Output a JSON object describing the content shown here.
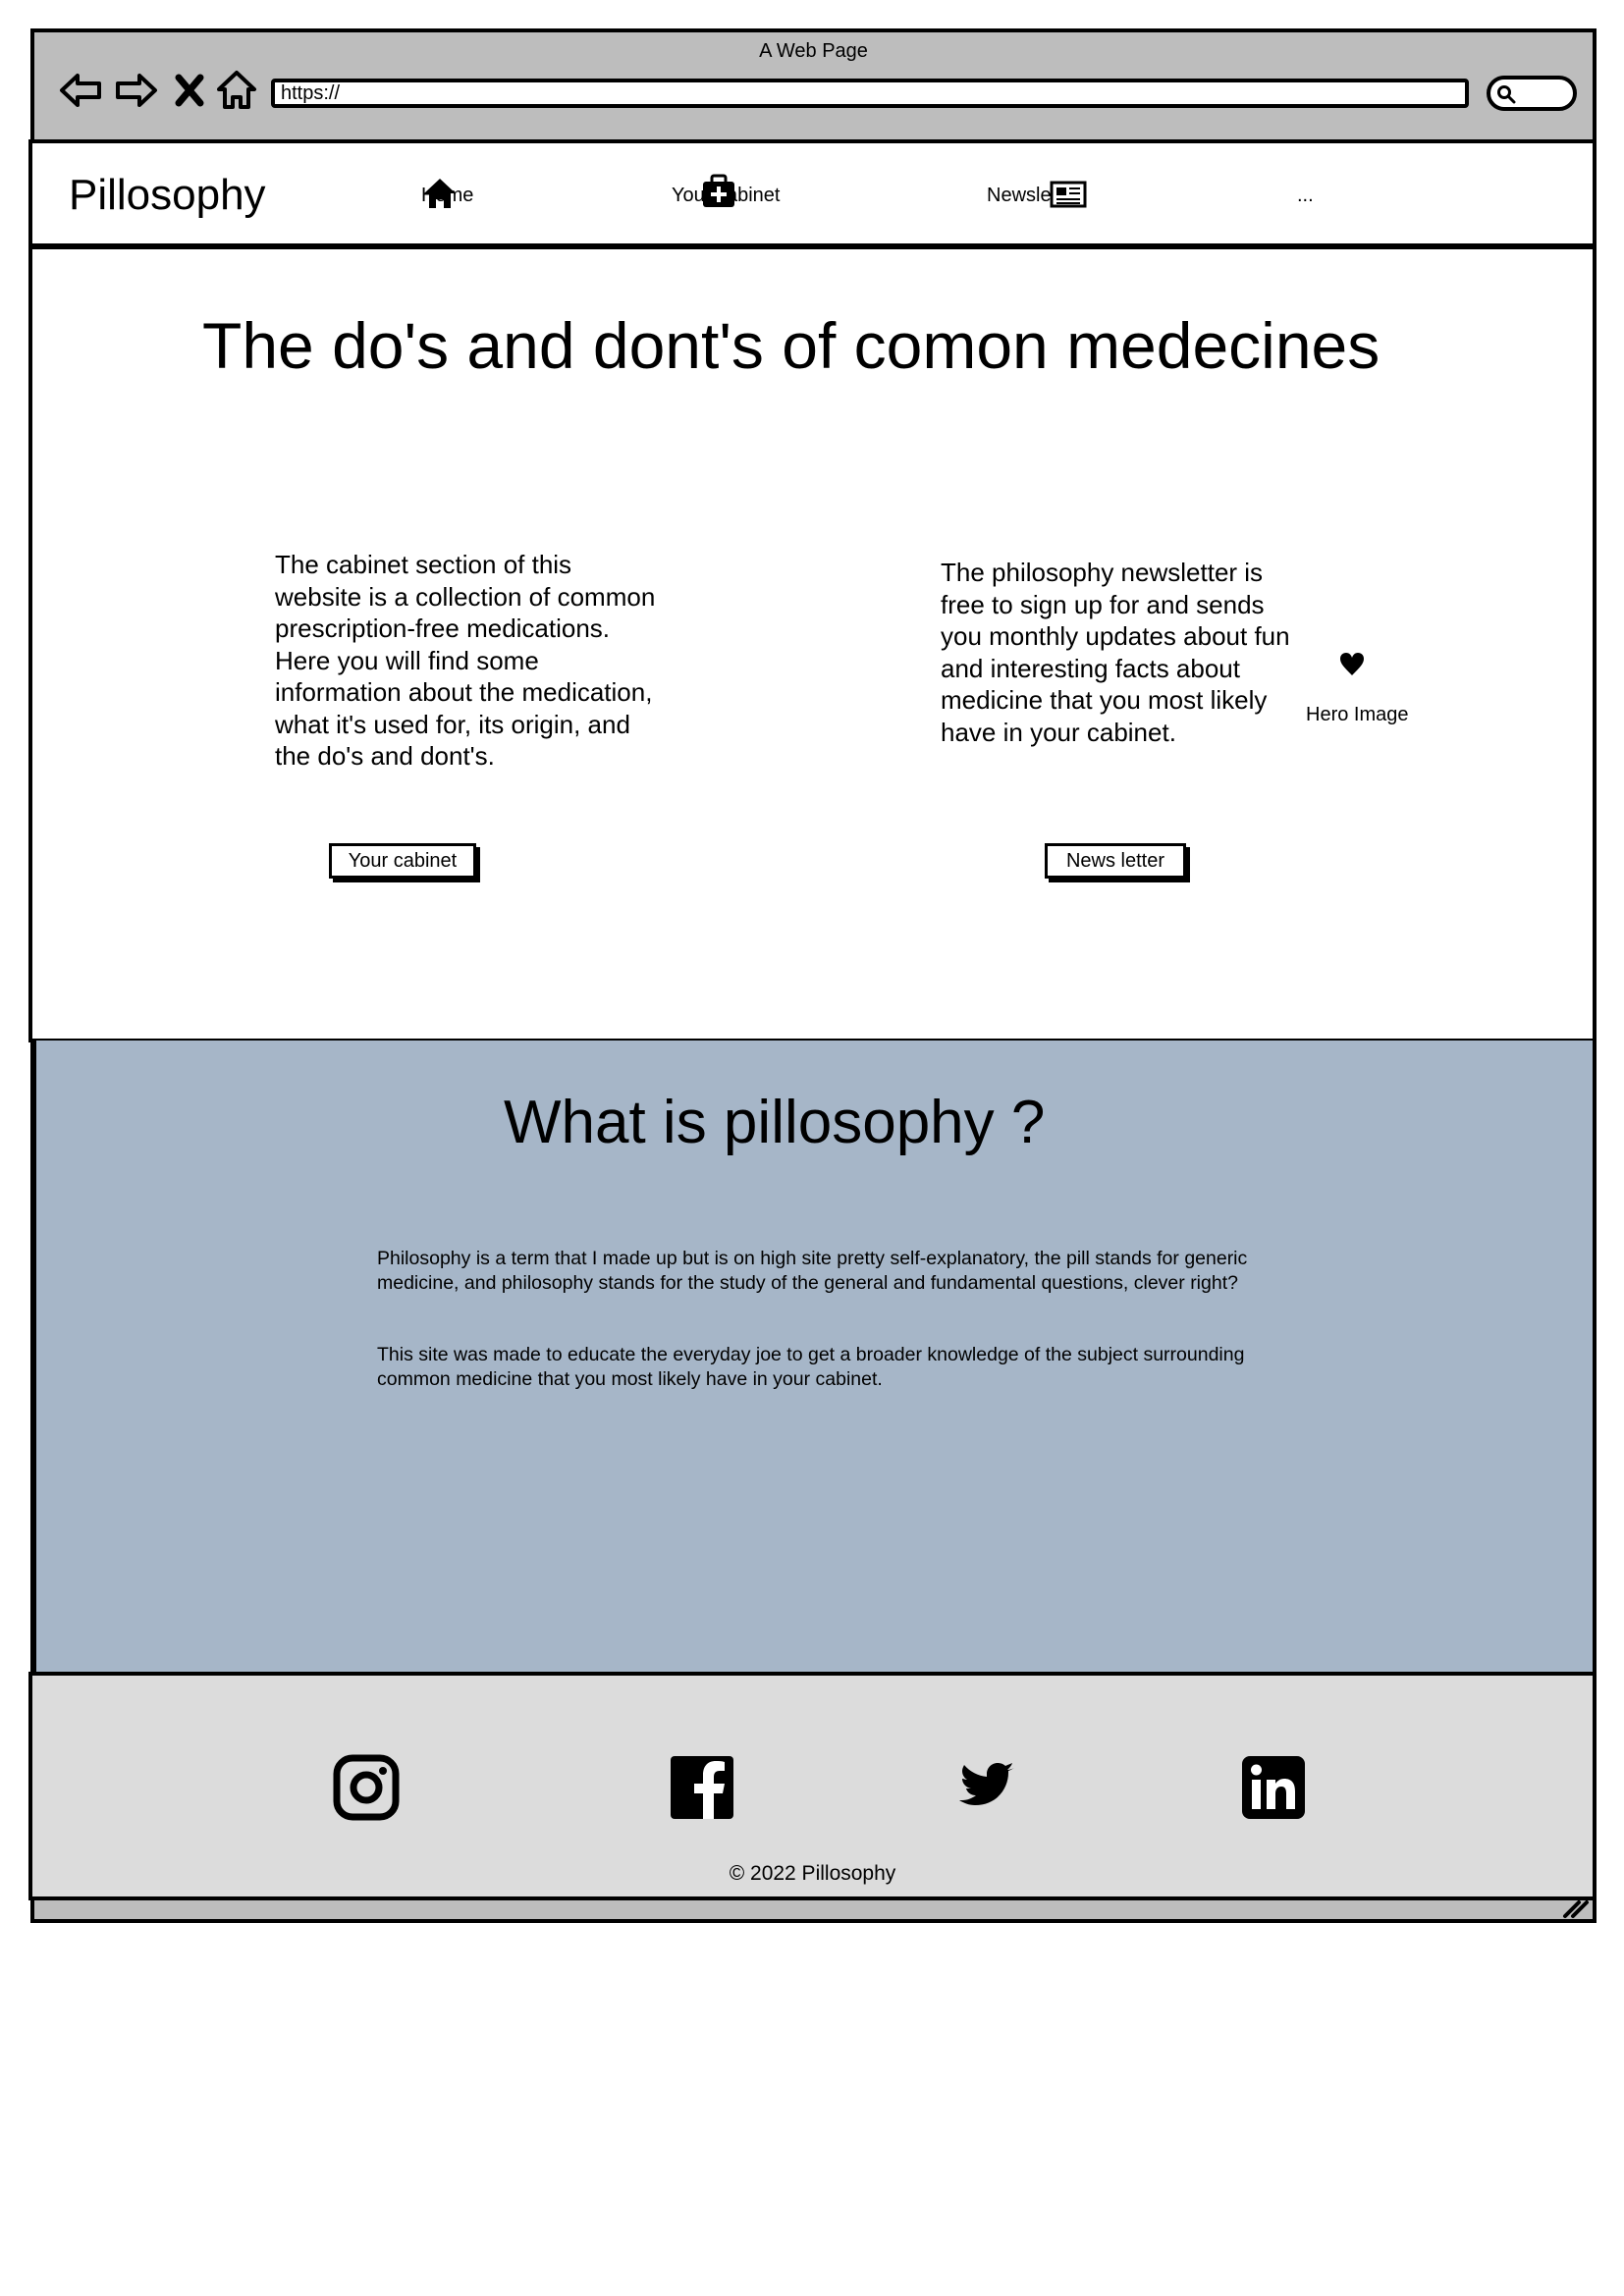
{
  "window": {
    "title": "A Web Page",
    "url": "https://",
    "icons": [
      "back-arrow-icon",
      "forward-arrow-icon",
      "close-x-icon",
      "home-outline-icon",
      "search-icon",
      "resize-handle-icon"
    ]
  },
  "header": {
    "brand": "Pillosophy",
    "nav": [
      {
        "label": "Home",
        "icon": "home-icon"
      },
      {
        "label": "Your cabinet",
        "icon": "medkit-icon"
      },
      {
        "label": "Newsletter",
        "icon": "newspaper-icon"
      },
      {
        "label": "..."
      }
    ]
  },
  "hero": {
    "title": "The do's and dont's of comon medecines",
    "cabinet_text": "The cabinet section of this website is a collection of common prescription-free medications. Here you will find some information about the medication, what it's used for, its origin, and the do's and dont's.",
    "cabinet_button": "Your cabinet",
    "newsletter_text": "The philosophy newsletter is free to sign up for and sends you monthly updates about fun and interesting facts about medicine that you most likely have in your cabinet.",
    "newsletter_button": "News letter",
    "hero_image_label": "Hero Image",
    "hero_image_icon": "heart-icon"
  },
  "about": {
    "title": "What is pillosophy ?",
    "paragraph1": "Philosophy is a term that I made up but is on high site pretty self-explanatory, the pill stands for generic medicine, and philosophy stands for the study of the general and fundamental questions, clever right?",
    "paragraph2": "This site was made to educate the everyday joe to get a broader knowledge of the subject surrounding common medicine that you most likely have in your cabinet.",
    "background_color": "#a6b6c8"
  },
  "footer": {
    "social": [
      "instagram-icon",
      "facebook-icon",
      "twitter-icon",
      "linkedin-icon"
    ],
    "copyright": "© 2022 Pillosophy",
    "background_color": "#dcdcdc"
  }
}
